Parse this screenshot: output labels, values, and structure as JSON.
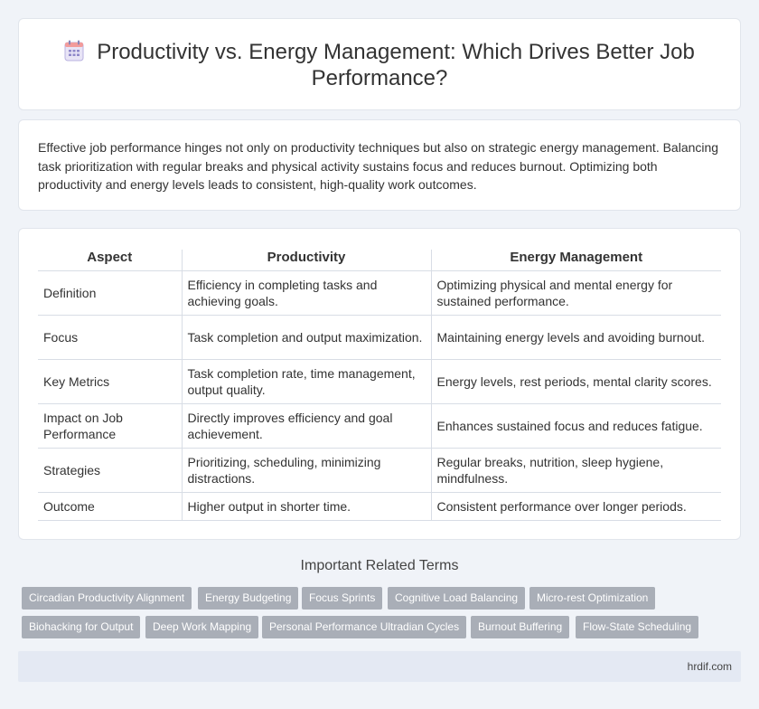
{
  "header": {
    "icon": "calendar-icon",
    "title": "Productivity vs. Energy Management: Which Drives Better Job Performance?"
  },
  "intro": {
    "text": "Effective job performance hinges not only on productivity techniques but also on strategic energy management. Balancing task prioritization with regular breaks and physical activity sustains focus and reduces burnout. Optimizing both productivity and energy levels leads to consistent, high-quality work outcomes."
  },
  "table": {
    "headers": [
      "Aspect",
      "Productivity",
      "Energy Management"
    ],
    "rows": [
      [
        "Definition",
        "Efficiency in completing tasks and achieving goals.",
        "Optimizing physical and mental energy for sustained performance."
      ],
      [
        "Focus",
        "Task completion and output maximization.",
        "Maintaining energy levels and avoiding burnout."
      ],
      [
        "Key Metrics",
        "Task completion rate, time management, output quality.",
        "Energy levels, rest periods, mental clarity scores."
      ],
      [
        "Impact on Job Performance",
        "Directly improves efficiency and goal achievement.",
        "Enhances sustained focus and reduces fatigue."
      ],
      [
        "Strategies",
        "Prioritizing, scheduling, minimizing distractions.",
        "Regular breaks, nutrition, sleep hygiene, mindfulness."
      ],
      [
        "Outcome",
        "Higher output in shorter time.",
        "Consistent performance over longer periods."
      ]
    ]
  },
  "related": {
    "title": "Important Related Terms",
    "tags": [
      "Circadian Productivity Alignment",
      "Energy Budgeting",
      "Focus Sprints",
      "Cognitive Load Balancing",
      "Micro-rest Optimization",
      "Biohacking for Output",
      "Deep Work Mapping",
      "Personal Performance Ultradian Cycles",
      "Burnout Buffering",
      "Flow-State Scheduling"
    ]
  },
  "footer": {
    "site": "hrdif.com"
  },
  "colors": {
    "tag_bg": "#a9aeb7",
    "page_bg": "#f0f3f8",
    "footer_bg": "#e4e9f3"
  }
}
